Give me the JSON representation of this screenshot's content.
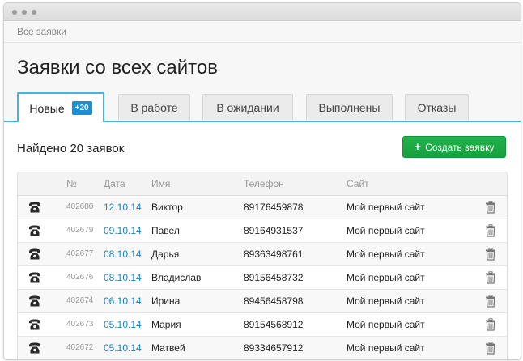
{
  "breadcrumb": "Все заявки",
  "page_title": "Заявки со всех сайтов",
  "tabs": [
    {
      "label": "Новые",
      "badge": "+20",
      "active": true
    },
    {
      "label": "В работе"
    },
    {
      "label": "В ожидании"
    },
    {
      "label": "Выполнены"
    },
    {
      "label": "Отказы"
    }
  ],
  "found_text": "Найдено 20 заявок",
  "create_button": {
    "icon": "plus-icon",
    "label": "Создать заявку"
  },
  "table": {
    "headers": [
      "№",
      "Дата",
      "Имя",
      "Телефон",
      "Сайт"
    ],
    "rows": [
      {
        "id": "402680",
        "date": "12.10.14",
        "name": "Виктор",
        "phone": "89176459878",
        "site": "Мой первый сайт"
      },
      {
        "id": "402679",
        "date": "09.10.14",
        "name": "Павел",
        "phone": "89164931537",
        "site": "Мой первый сайт"
      },
      {
        "id": "402677",
        "date": "08.10.14",
        "name": "Дарья",
        "phone": "89363498761",
        "site": "Мой первый сайт"
      },
      {
        "id": "402676",
        "date": "08.10.14",
        "name": "Владислав",
        "phone": "89156458732",
        "site": "Мой первый сайт"
      },
      {
        "id": "402674",
        "date": "06.10.14",
        "name": "Ирина",
        "phone": "89456458798",
        "site": "Мой первый сайт"
      },
      {
        "id": "402673",
        "date": "05.10.14",
        "name": "Мария",
        "phone": "89154568912",
        "site": "Мой первый сайт"
      },
      {
        "id": "402672",
        "date": "05.10.14",
        "name": "Матвей",
        "phone": "89334657912",
        "site": "Мой первый сайт"
      }
    ]
  },
  "icons": {
    "row_call": "phone-icon",
    "row_delete": "trash-icon"
  },
  "colors": {
    "accent": "#4ab2d9",
    "badge": "#1a8fd6",
    "create_button": "#1fae48",
    "date_link": "#1a7fc1"
  }
}
